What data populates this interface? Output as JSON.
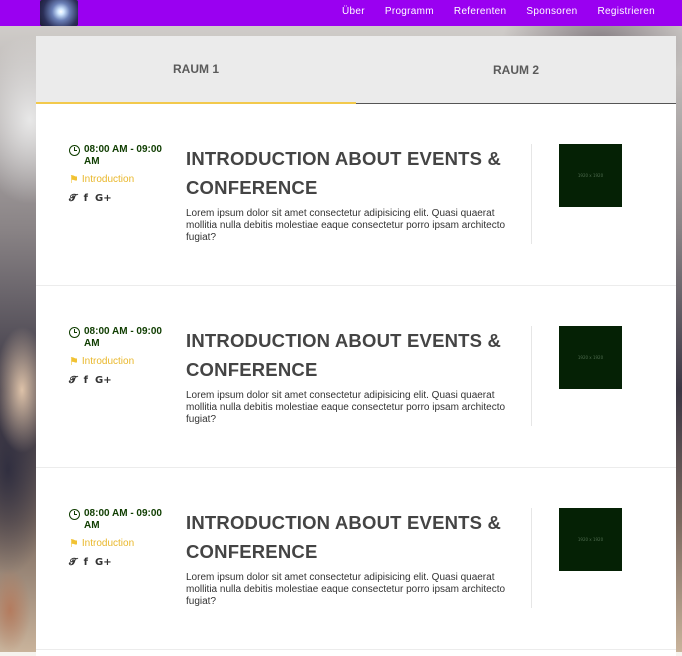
{
  "nav": {
    "links": [
      "Über",
      "Programm",
      "Referenten",
      "Sponsoren",
      "Registrieren"
    ]
  },
  "tabs": [
    "RAUM 1",
    "RAUM 2"
  ],
  "sessions": [
    {
      "time": "08:00 AM - 09:00 AM",
      "tag": "Introduction",
      "title": "INTRODUCTION ABOUT EVENTS & CONFERENCE",
      "description": "Lorem ipsum dolor sit amet consectetur adipisicing elit. Quasi quaerat mollitia nulla debitis molestiae eaque consectetur porro ipsam architecto fugiat?",
      "thumb_text": "1920 x 1920"
    },
    {
      "time": "08:00 AM - 09:00 AM",
      "tag": "Introduction",
      "title": "INTRODUCTION ABOUT EVENTS & CONFERENCE",
      "description": "Lorem ipsum dolor sit amet consectetur adipisicing elit. Quasi quaerat mollitia nulla debitis molestiae eaque consectetur porro ipsam architecto fugiat?",
      "thumb_text": "1920 x 1920"
    },
    {
      "time": "08:00 AM - 09:00 AM",
      "tag": "Introduction",
      "title": "INTRODUCTION ABOUT EVENTS & CONFERENCE",
      "description": "Lorem ipsum dolor sit amet consectetur adipisicing elit. Quasi quaerat mollitia nulla debitis molestiae eaque consectetur porro ipsam architecto fugiat?",
      "thumb_text": "1920 x 1920"
    }
  ],
  "icons": {
    "clock": "clock-icon",
    "tag": "tag-icon",
    "social": [
      "twitter-icon",
      "facebook-icon",
      "google-plus-icon"
    ]
  },
  "colors": {
    "navbar": "#9a00f1",
    "accent": "#f2c94c",
    "time": "#0f3d00"
  }
}
